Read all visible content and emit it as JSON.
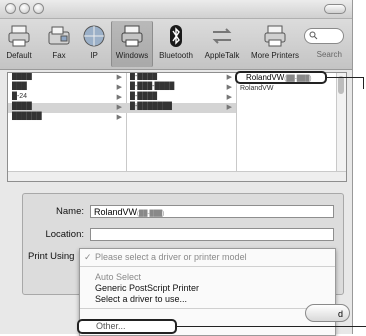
{
  "toolbar": {
    "items": [
      {
        "label": "Default",
        "icon": "default-printer-icon"
      },
      {
        "label": "Fax",
        "icon": "fax-icon"
      },
      {
        "label": "IP",
        "icon": "ip-globe-icon"
      },
      {
        "label": "Windows",
        "icon": "windows-printer-icon",
        "selected": true
      },
      {
        "label": "Bluetooth",
        "icon": "bluetooth-icon"
      },
      {
        "label": "AppleTalk",
        "icon": "appletalk-icon"
      },
      {
        "label": "More Printers",
        "icon": "more-printers-icon"
      }
    ],
    "search_label": "Search"
  },
  "browser": {
    "col1": [
      "████",
      "███",
      "█-24",
      "████",
      "██████"
    ],
    "col2": [
      "█-████",
      "█-███-████",
      "█-████",
      "█-███████"
    ],
    "col3_selected": "RolandVW",
    "col3_selected_suffix": "(██-███)",
    "col3_second": "RolandVW"
  },
  "form": {
    "name_label": "Name:",
    "name_value": "RolandVW",
    "name_suffix": "(██-███)",
    "location_label": "Location:",
    "location_value": "",
    "print_using_label": "Print Using"
  },
  "menu": {
    "checked_item": "Please select a driver or printer model",
    "checkmark": "✓",
    "items": [
      "Auto Select",
      "Generic PostScript Printer",
      "Select a driver to use..."
    ],
    "other": "Other...",
    "cancel_partial": "d"
  }
}
